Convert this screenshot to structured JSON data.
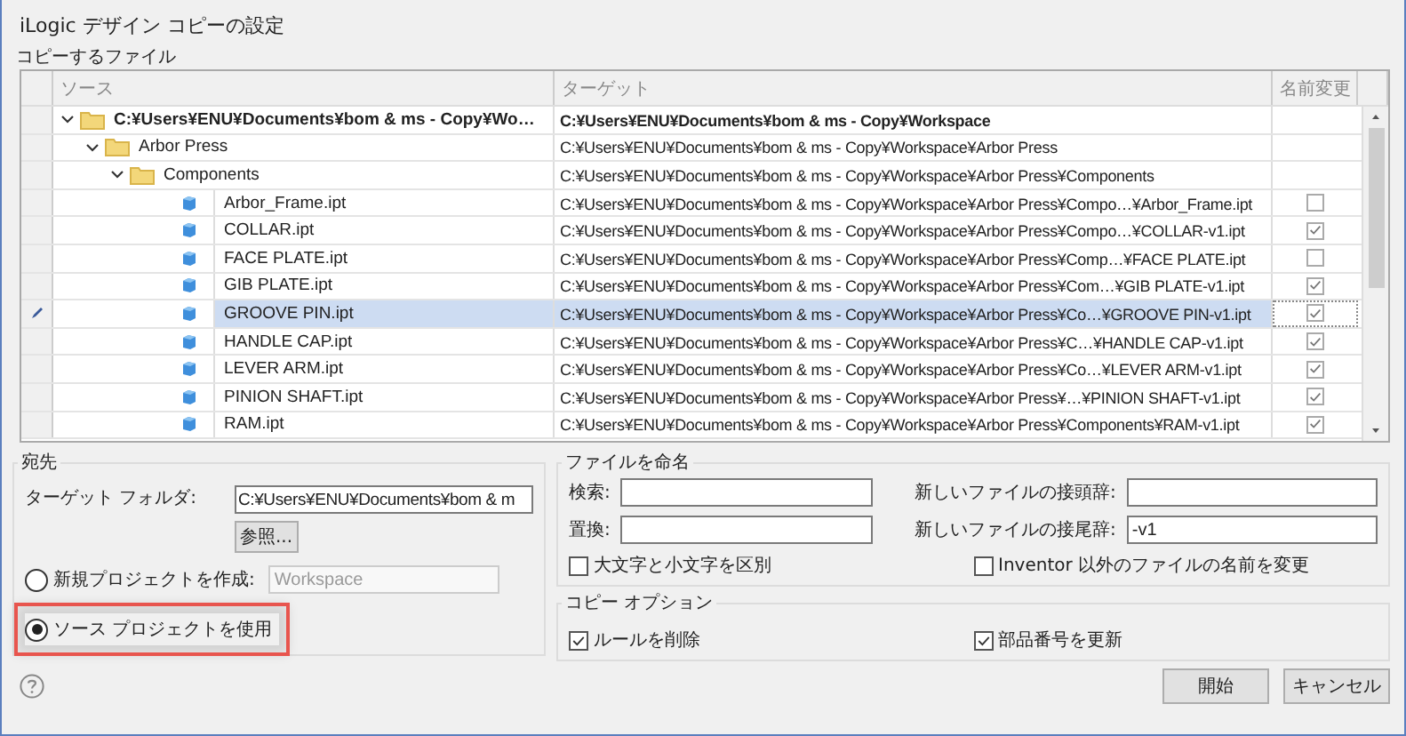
{
  "window": {
    "title": "iLogic デザイン コピーの設定"
  },
  "table": {
    "title": "コピーするファイル",
    "columns": [
      "ソース",
      "ターゲット",
      "名前変更"
    ],
    "rows": [
      {
        "kind": "root",
        "source": "C:¥Users¥ENU¥Documents¥bom & ms - Copy¥Wo…",
        "target": "C:¥Users¥ENU¥Documents¥bom & ms - Copy¥Workspace",
        "expanded": true,
        "selected": false,
        "children": [
          {
            "kind": "folder",
            "source": "Arbor Press",
            "target": "C:¥Users¥ENU¥Documents¥bom & ms - Copy¥Workspace¥Arbor Press",
            "expanded": true,
            "selected": false,
            "children": [
              {
                "kind": "folder",
                "source": "Components",
                "target": "C:¥Users¥ENU¥Documents¥bom & ms - Copy¥Workspace¥Arbor Press¥Components",
                "expanded": true,
                "selected": false,
                "children": [
                  {
                    "kind": "file",
                    "source": "Arbor_Frame.ipt",
                    "target": "C:¥Users¥ENU¥Documents¥bom & ms - Copy¥Workspace¥Arbor Press¥Compo…¥Arbor_Frame.ipt",
                    "rename": false,
                    "selected": false
                  },
                  {
                    "kind": "file",
                    "source": "COLLAR.ipt",
                    "target": "C:¥Users¥ENU¥Documents¥bom & ms - Copy¥Workspace¥Arbor Press¥Compo…¥COLLAR-v1.ipt",
                    "rename": true,
                    "selected": false
                  },
                  {
                    "kind": "file",
                    "source": "FACE PLATE.ipt",
                    "target": "C:¥Users¥ENU¥Documents¥bom & ms - Copy¥Workspace¥Arbor Press¥Comp…¥FACE PLATE.ipt",
                    "rename": false,
                    "selected": false
                  },
                  {
                    "kind": "file",
                    "source": "GIB PLATE.ipt",
                    "target": "C:¥Users¥ENU¥Documents¥bom & ms - Copy¥Workspace¥Arbor Press¥Com…¥GIB PLATE-v1.ipt",
                    "rename": true,
                    "selected": false
                  },
                  {
                    "kind": "file",
                    "source": "GROOVE PIN.ipt",
                    "target": "C:¥Users¥ENU¥Documents¥bom & ms - Copy¥Workspace¥Arbor Press¥Co…¥GROOVE PIN-v1.ipt",
                    "rename": true,
                    "selected": true
                  },
                  {
                    "kind": "file",
                    "source": "HANDLE CAP.ipt",
                    "target": "C:¥Users¥ENU¥Documents¥bom & ms - Copy¥Workspace¥Arbor Press¥C…¥HANDLE CAP-v1.ipt",
                    "rename": true,
                    "selected": false
                  },
                  {
                    "kind": "file",
                    "source": "LEVER ARM.ipt",
                    "target": "C:¥Users¥ENU¥Documents¥bom & ms - Copy¥Workspace¥Arbor Press¥Co…¥LEVER ARM-v1.ipt",
                    "rename": true,
                    "selected": false
                  },
                  {
                    "kind": "file",
                    "source": "PINION SHAFT.ipt",
                    "target": "C:¥Users¥ENU¥Documents¥bom & ms - Copy¥Workspace¥Arbor Press¥…¥PINION SHAFT-v1.ipt",
                    "rename": true,
                    "selected": false
                  },
                  {
                    "kind": "file",
                    "source": "RAM.ipt",
                    "target": "C:¥Users¥ENU¥Documents¥bom & ms - Copy¥Workspace¥Arbor Press¥Components¥RAM-v1.ipt",
                    "rename": true,
                    "selected": false
                  }
                ]
              }
            ]
          }
        ]
      }
    ]
  },
  "destination": {
    "title": "宛先",
    "folder_label": "ターゲット フォルダ:",
    "folder_value": "C:¥Users¥ENU¥Documents¥bom & m",
    "browse_button": "参照...",
    "options": [
      {
        "label": "新規プロジェクトを作成:",
        "selected": false,
        "field_value": "Workspace",
        "field_disabled": true
      },
      {
        "label": "ソース プロジェクトを使用",
        "selected": true,
        "highlighted": true
      }
    ]
  },
  "naming": {
    "title": "ファイルを命名",
    "fields": [
      {
        "label": "検索:"
      },
      {
        "label": "新しいファイルの接頭辞:"
      },
      {
        "label": "置換:"
      },
      {
        "label": "新しいファイルの接尾辞:",
        "value": "-v1"
      }
    ],
    "checkboxes": [
      {
        "label": "大文字と小文字を区別",
        "checked": false
      },
      {
        "label": "Inventor 以外のファイルの名前を変更",
        "checked": false
      }
    ]
  },
  "copy_options": {
    "title": "コピー オプション",
    "checkboxes": [
      {
        "label": "ルールを削除",
        "checked": true
      },
      {
        "label": "部品番号を更新",
        "checked": true
      }
    ]
  },
  "buttons": [
    "開始",
    "キャンセル"
  ]
}
